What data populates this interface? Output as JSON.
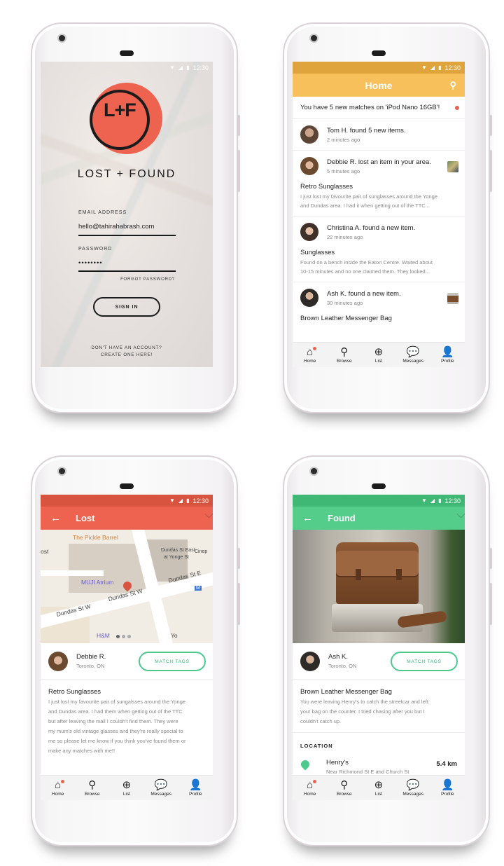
{
  "status": {
    "time": "12:30"
  },
  "colors": {
    "red": "#ee6350",
    "yellow": "#f7c05a",
    "green": "#54cc8a",
    "red_status": "#d9543f",
    "yellow_status": "#dfa53c",
    "green_status": "#3fb875"
  },
  "login": {
    "logo_text": "L+F",
    "brand": "LOST + FOUND",
    "email_label": "EMAIL ADDRESS",
    "email_value": "hello@tahirahabrash.com",
    "password_label": "PASSWORD",
    "password_value": "••••••••",
    "forgot": "FORGOT PASSWORD?",
    "signin": "SIGN IN",
    "create_line1": "DON'T HAVE AN ACCOUNT?",
    "create_line2": "CREATE ONE HERE!"
  },
  "home": {
    "title": "Home",
    "search_icon": "search-icon",
    "notification": "You have 5 new matches on 'iPod Nano 16GB'!",
    "feed": [
      {
        "title": "Tom H. found 5 new items.",
        "time": "2 minutes ago"
      },
      {
        "title": "Debbie R. lost an item in your area.",
        "time": "5 minutes ago",
        "item": "Retro Sunglasses",
        "desc1": "I just lost my favourite pair of sunglasses around the Yonge",
        "desc2": "and Dundas area. I had it when getting out of the TTC..."
      },
      {
        "title": "Christina A. found a new item.",
        "time": "22 minutes ago",
        "item": "Sunglasses",
        "desc1": "Found on a bench inside the Eaton Centre. Waited about",
        "desc2": "10-15 minutes and no one claimed them. They looked..."
      },
      {
        "title": "Ash K. found a new item.",
        "time": "30 minutes ago",
        "item": "Brown Leather Messenger Bag"
      }
    ]
  },
  "nav": {
    "home": "Home",
    "browse": "Browse",
    "list": "List",
    "messages": "Messages",
    "profile": "Profile"
  },
  "lost": {
    "title": "Lost",
    "map_labels": {
      "pickle": "The Pickle Barrel",
      "ost": "ost",
      "dundas_east": "Dundas St East",
      "at_yonge": "at Yonge St",
      "cine": "Cinep",
      "muji": "MUJI Atrium",
      "dundas_e": "Dundas St E",
      "dundas_w1": "Dundas St W",
      "dundas_w2": "Dundas St W",
      "hm": "H&M",
      "m": "M",
      "yo": "Yo"
    },
    "name": "Debbie R.",
    "location": "Toronto, ON",
    "match": "MATCH TAGS",
    "item": "Retro Sunglasses",
    "desc": [
      "I just lost my favourite pair of sungalsses around the Yonge",
      "and Dundas area. I had them when getting out of the TTC",
      "but after leaving the mall I couldn't find them. They were",
      "my mum's old vintage glasses and they're really special to",
      "me so please let me know if you think you've found them or",
      "make any matches with me!!"
    ]
  },
  "found": {
    "title": "Found",
    "name": "Ash K.",
    "location": "Toronto, ON",
    "match": "MATCH TAGS",
    "item": "Brown Leather Messenger Bag",
    "desc": [
      "You were leaving Henry's to catch the streetcar and left",
      "your bag on the counter. I tried chasing after you but I",
      "couldn't catch up."
    ],
    "location_heading": "LOCATION",
    "place": "Henry's",
    "place_address": "Near Richmond St E and Church St",
    "distance": "5.4 km"
  }
}
